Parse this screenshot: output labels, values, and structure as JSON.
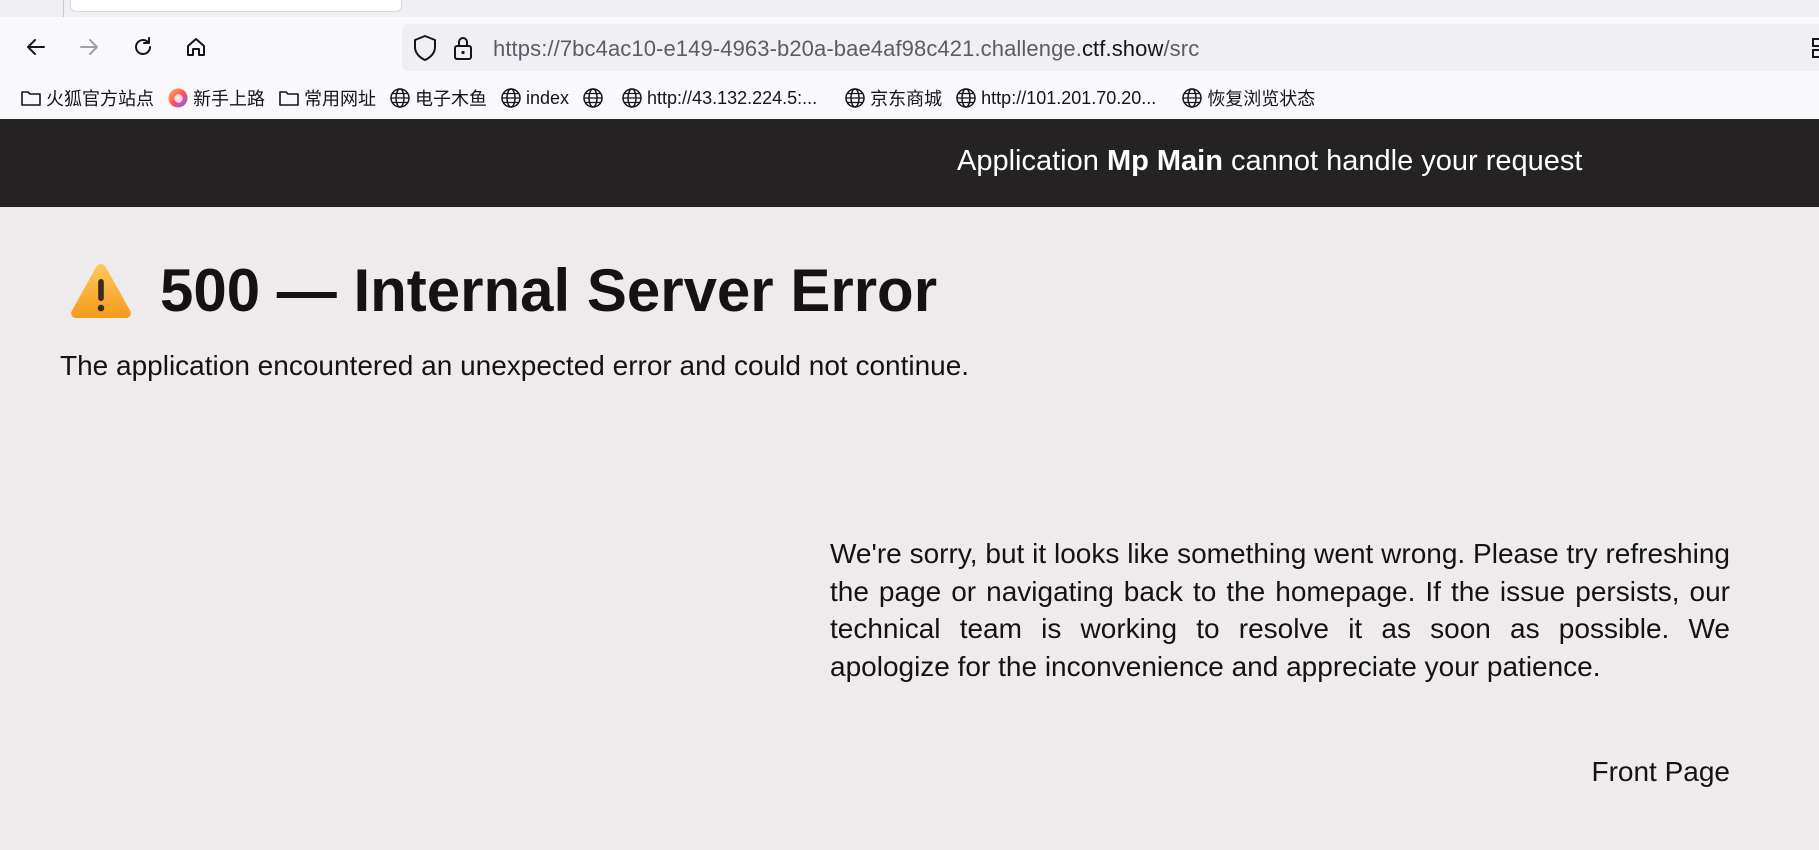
{
  "browser": {
    "url": {
      "prefix": "https://7bc4ac10-e149-4963-b20a-bae4af98c421.challenge.",
      "domain": "ctf.show",
      "path": "/src"
    },
    "bookmarks": [
      {
        "label": "火狐官方站点",
        "icon": "folder-icon"
      },
      {
        "label": "新手上路",
        "icon": "firefox-icon"
      },
      {
        "label": "常用网址",
        "icon": "folder-icon"
      },
      {
        "label": "电子木鱼",
        "icon": "globe-icon"
      },
      {
        "label": "index",
        "icon": "globe-icon"
      },
      {
        "label": "",
        "icon": "globe-icon"
      },
      {
        "label": "http://43.132.224.5:...",
        "icon": "globe-icon"
      },
      {
        "label": "京东商城",
        "icon": "globe-icon"
      },
      {
        "label": "http://101.201.70.20...",
        "icon": "globe-icon"
      },
      {
        "label": "恢复浏览状态",
        "icon": "globe-icon"
      }
    ]
  },
  "header": {
    "pre": "Application ",
    "app_name": "Mp Main",
    "post": " cannot handle your request"
  },
  "error": {
    "icon": "warning-icon",
    "title": "500 — Internal Server Error",
    "subtitle": "The application encountered an unexpected error and could not continue.",
    "apology": "We're sorry, but it looks like something went wrong. Please try refreshing the page or navigating back to the homepage. If the issue persists, our technical team is working to resolve it as soon as possible. We apologize for the inconvenience and appreciate your patience.",
    "front_page_label": "Front Page"
  },
  "colors": {
    "header_bg": "#252223",
    "page_bg": "#edebeb",
    "text": "#141213"
  }
}
